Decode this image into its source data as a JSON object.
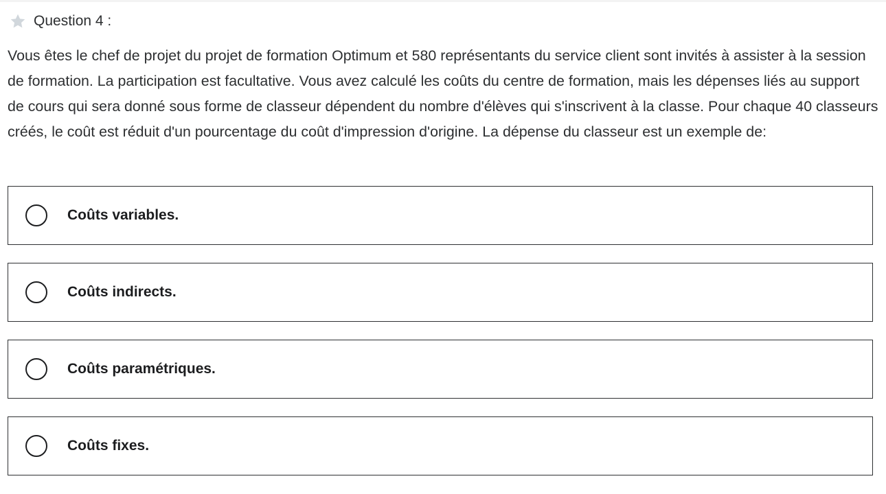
{
  "question": {
    "title": "Question 4 :",
    "star_icon": "star-icon",
    "text": "Vous êtes le chef de projet du projet de formation Optimum et 580 représentants du service client sont invités à assister à la session de formation. La participation est facultative. Vous avez calculé les coûts du centre de formation, mais les dépenses liés au support de cours qui sera donné sous forme de classeur dépendent du nombre d'élèves qui s'inscrivent à la classe. Pour chaque 40 classeurs créés, le coût est réduit d'un pourcentage du coût d'impression d'origine. La dépense du classeur est un exemple de:"
  },
  "answers": [
    {
      "label": "Coûts variables."
    },
    {
      "label": "Coûts indirects."
    },
    {
      "label": "Coûts paramétriques."
    },
    {
      "label": "Coûts fixes."
    }
  ],
  "colors": {
    "text": "#2d2f31",
    "star": "#d1d7dc",
    "border": "#2d2f31"
  }
}
